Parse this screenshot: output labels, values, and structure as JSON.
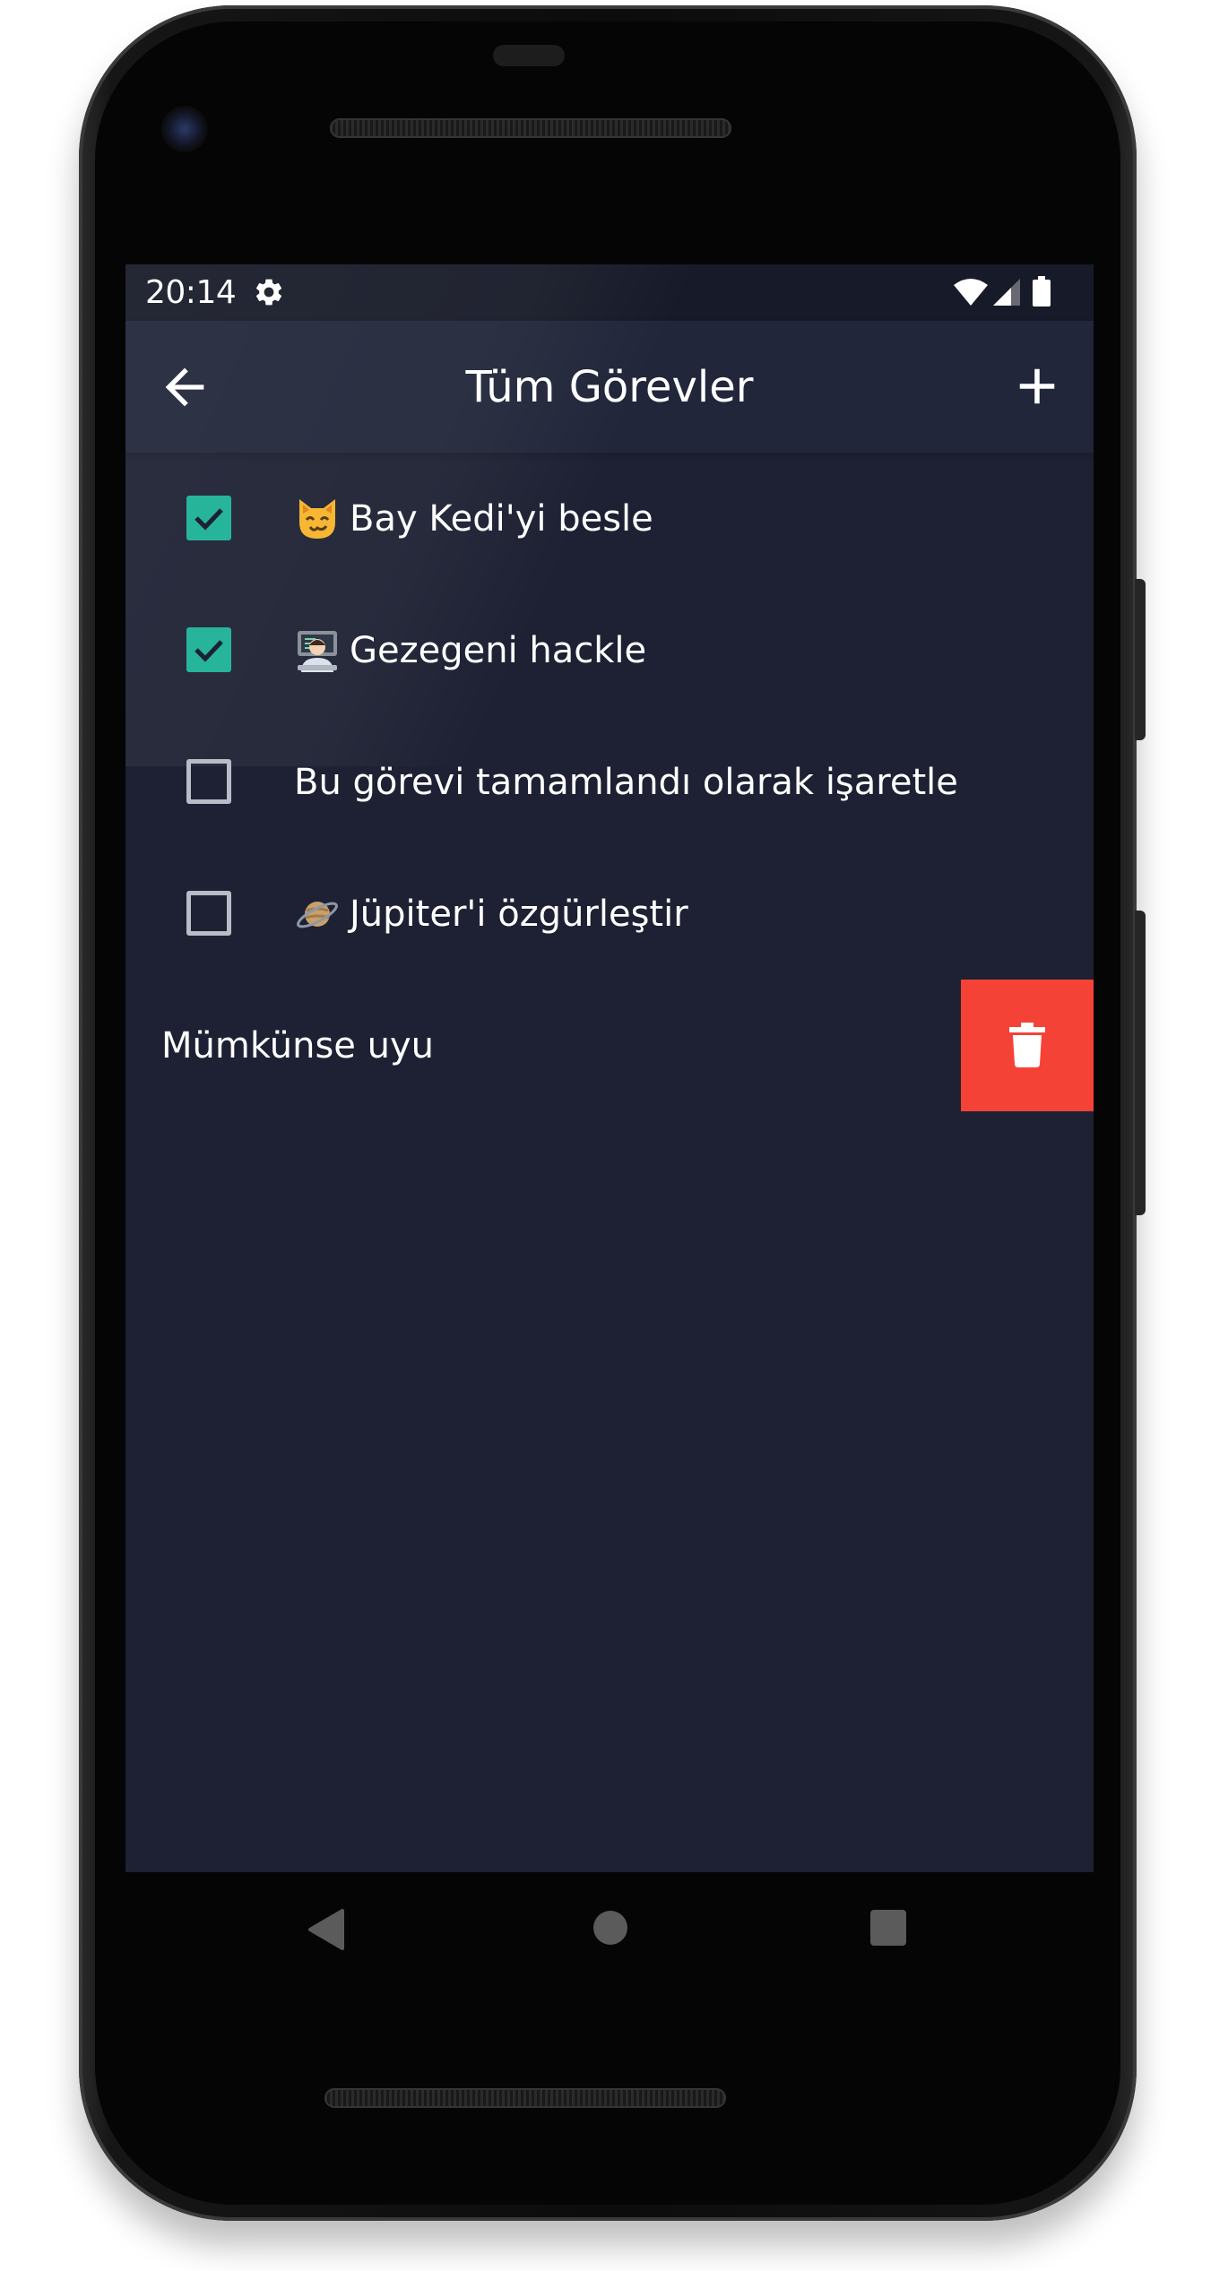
{
  "status_bar": {
    "time": "20:14",
    "settings_icon": "gear-icon",
    "right_icons": [
      "wifi-icon",
      "cellular-signal-icon",
      "battery-icon"
    ]
  },
  "app_bar": {
    "title": "Tüm Görevler",
    "back_icon": "arrow-left-icon",
    "add_icon": "plus-icon"
  },
  "tasks": [
    {
      "emoji": "cat-face-icon",
      "label": "Bay Kedi'yi besle",
      "done": true
    },
    {
      "emoji": "technologist-icon",
      "label": "Gezegeni hackle",
      "done": true
    },
    {
      "emoji": "",
      "label": "Bu görevi tamamlandı olarak işaretle",
      "done": false
    },
    {
      "emoji": "ringed-planet-icon",
      "label": "Jüpiter'i özgürleştir",
      "done": false
    }
  ],
  "swiped_task": {
    "label": "Mümkünse uyu",
    "action_icon": "trash-icon"
  },
  "colors": {
    "background": "#1d2133",
    "app_bar": "#21263a",
    "check_accent": "#26b59b",
    "delete_red": "#f44336",
    "text": "#ffffff"
  },
  "nav_bar": {
    "icons": [
      "nav-back-icon",
      "nav-home-icon",
      "nav-recent-apps-icon"
    ]
  }
}
